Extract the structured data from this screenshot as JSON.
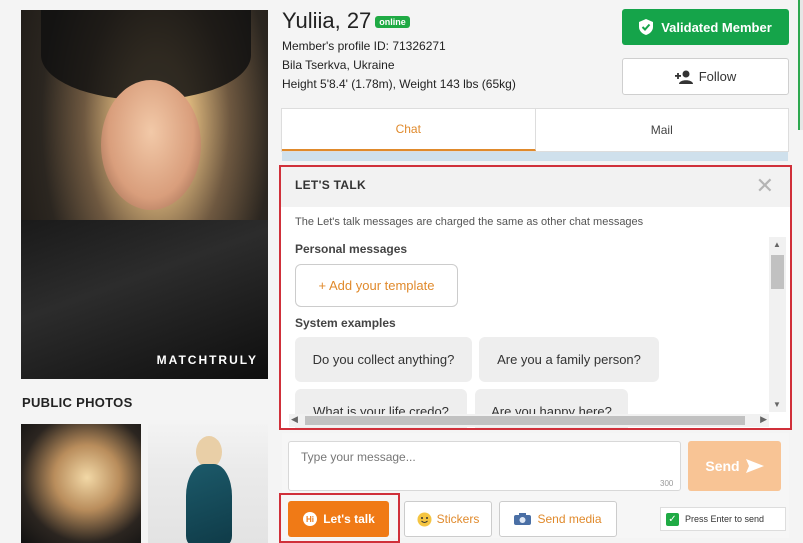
{
  "profile": {
    "name": "Yuliia, 27",
    "status": "online",
    "id_line": "Member's profile ID: 71326271",
    "location": "Bila Tserkva, Ukraine",
    "stats": "Height 5'8.4' (1.78m), Weight 143 lbs (65kg)"
  },
  "photo": {
    "watermark": "MATCHTRULY"
  },
  "public_photos": {
    "title": "PUBLIC PHOTOS"
  },
  "actions": {
    "validated": "Validated Member",
    "follow": "Follow"
  },
  "tabs": [
    {
      "label": "Chat"
    },
    {
      "label": "Mail"
    }
  ],
  "lets_talk": {
    "title": "LET'S TALK",
    "close": "✕",
    "note": "The Let's talk messages are charged the same as other chat messages",
    "personal_title": "Personal messages",
    "add_template": "+ Add your template",
    "system_title": "System examples",
    "examples": [
      "Do you collect anything?",
      "Are you a family person?",
      "What is your life credo?",
      "Are you happy here?"
    ]
  },
  "composer": {
    "placeholder": "Type your message...",
    "counter": "300",
    "send": "Send",
    "lets_talk": "Let's talk",
    "stickers": "Stickers",
    "send_media": "Send media",
    "press_enter": "Press Enter to send"
  },
  "colors": {
    "accent": "#e08a2c",
    "green": "#15a44a",
    "highlight": "#d0303a",
    "orange": "#f07a16"
  }
}
